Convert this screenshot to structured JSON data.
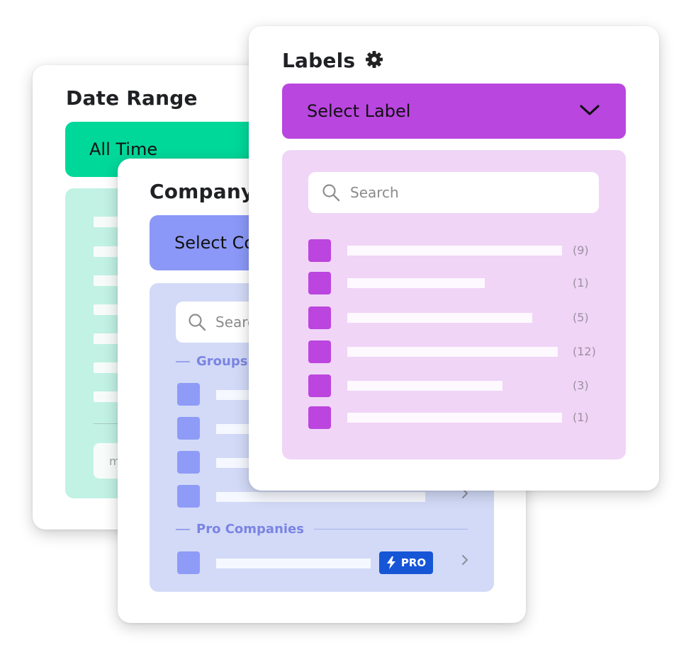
{
  "date_card": {
    "title": "Date Range",
    "button_label": "All Time",
    "input_stub_text": "m"
  },
  "company_card": {
    "title": "Company",
    "button_label": "Select Co",
    "search_placeholder": "Searc",
    "groups_label": "Groups",
    "pro_label": "Pro Companies",
    "pro_badge_text": "PRO"
  },
  "labels_card": {
    "title": "Labels",
    "button_label": "Select Label",
    "search_placeholder": "Search",
    "items": [
      {
        "count": "(9)"
      },
      {
        "count": "(1)"
      },
      {
        "count": "(5)"
      },
      {
        "count": "(12)"
      },
      {
        "count": "(3)"
      },
      {
        "count": "(1)"
      }
    ]
  },
  "icons": {
    "settings": "gear-icon",
    "dropdown": "chevron-down-icon",
    "search": "search-icon",
    "row_arrow": "chevron-right-icon",
    "pro": "lightning-icon"
  },
  "colors": {
    "date_accent": "#00d89a",
    "company_accent": "#8b98f7",
    "labels_accent": "#b946df",
    "pro_badge": "#1656d6"
  }
}
